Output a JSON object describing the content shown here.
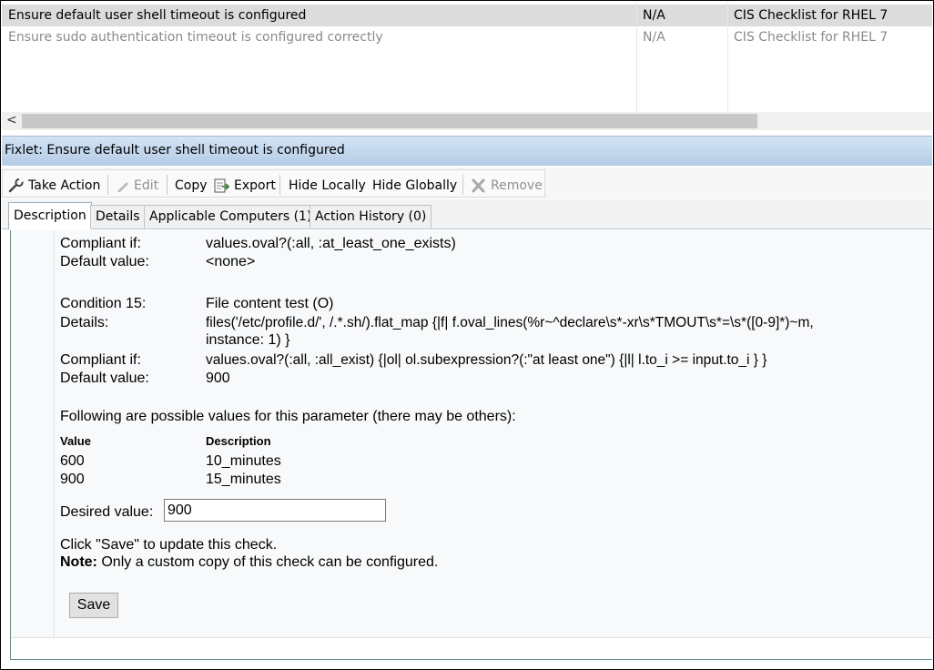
{
  "list": {
    "rows": [
      {
        "name": "Ensure default user shell timeout is configured",
        "status": "N/A",
        "site": "CIS Checklist for RHEL 7"
      },
      {
        "name": "Ensure sudo authentication timeout is configured correctly",
        "status": "N/A",
        "site": "CIS Checklist for RHEL 7"
      }
    ],
    "scroll_left_glyph": "<"
  },
  "title": "Fixlet: Ensure default user shell timeout is configured",
  "toolbar": {
    "take_action": "Take Action",
    "edit": "Edit",
    "copy": "Copy",
    "export": "Export",
    "hide_locally": "Hide Locally",
    "hide_globally": "Hide Globally",
    "remove": "Remove"
  },
  "tabs": [
    "Description",
    "Details",
    "Applicable Computers (1)",
    "Action History (0)"
  ],
  "description": {
    "prev": {
      "compliant_label": "Compliant if:",
      "compliant_value": "values.oval?(:all, :at_least_one_exists)",
      "default_label": "Default value:",
      "default_value": "<none>"
    },
    "condition": {
      "label": "Condition 15:",
      "value": "File content test (O)",
      "details_label": "Details:",
      "details_line1": "files('/etc/profile.d/', /.*.sh/).flat_map {|f| f.oval_lines(%r~^declare\\s*-xr\\s*TMOUT\\s*=\\s*([0-9]*)~m,",
      "details_line2": "instance: 1) }",
      "compliant_label": "Compliant if:",
      "compliant_value": "values.oval?(:all, :all_exist) {|ol| ol.subexpression?(:\"at least one\") {|l| l.to_i >= input.to_i } }",
      "default_label": "Default value:",
      "default_value": "900"
    },
    "possible_values_intro": "Following are possible values for this parameter (there may be others):",
    "table": {
      "headers": [
        "Value",
        "Description"
      ],
      "rows": [
        [
          "600",
          "10_minutes"
        ],
        [
          "900",
          "15_minutes"
        ]
      ]
    },
    "desired_label": "Desired value:",
    "desired_value": "900",
    "save_hint": "Click \"Save\" to update this check.",
    "note_label": "Note:",
    "note_text": "Only a custom copy of this check can be configured.",
    "save_button": "Save"
  }
}
